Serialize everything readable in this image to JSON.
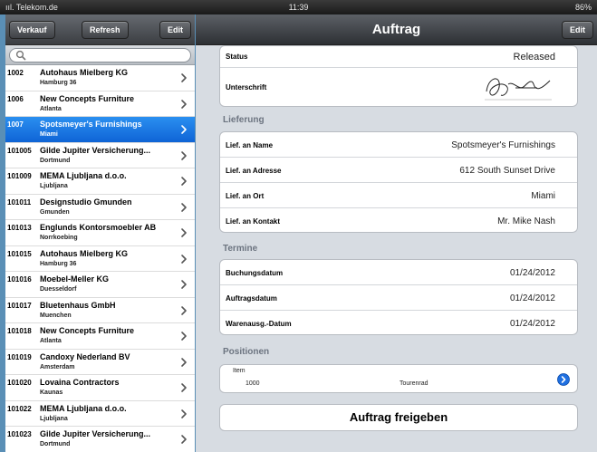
{
  "statusbar": {
    "carrier": "ııl. Telekom.de",
    "time": "11:39",
    "battery": "86%"
  },
  "master": {
    "nav": {
      "left_button": "Verkauf",
      "center_button": "Refresh",
      "right_button": "Edit"
    },
    "search": {
      "placeholder": ""
    },
    "rows": [
      {
        "num": "1002",
        "name": "Autohaus Mielberg KG",
        "city": "Hamburg 36"
      },
      {
        "num": "1006",
        "name": "New Concepts Furniture",
        "city": "Atlanta"
      },
      {
        "num": "1007",
        "name": "Spotsmeyer's Furnishings",
        "city": "Miami",
        "selected": true
      },
      {
        "num": "101005",
        "name": "Gilde Jupiter Versicherung...",
        "city": "Dortmund"
      },
      {
        "num": "101009",
        "name": "MEMA Ljubljana d.o.o.",
        "city": "Ljubljana"
      },
      {
        "num": "101011",
        "name": "Designstudio Gmunden",
        "city": "Gmunden"
      },
      {
        "num": "101013",
        "name": "Englunds Kontorsmoebler AB",
        "city": "Norrkoebing"
      },
      {
        "num": "101015",
        "name": "Autohaus Mielberg KG",
        "city": "Hamburg 36"
      },
      {
        "num": "101016",
        "name": "Moebel-Meller KG",
        "city": "Duesseldorf"
      },
      {
        "num": "101017",
        "name": "Bluetenhaus GmbH",
        "city": "Muenchen"
      },
      {
        "num": "101018",
        "name": "New Concepts Furniture",
        "city": "Atlanta"
      },
      {
        "num": "101019",
        "name": "Candoxy Nederland BV",
        "city": "Amsterdam"
      },
      {
        "num": "101020",
        "name": "Lovaina Contractors",
        "city": "Kaunas"
      },
      {
        "num": "101022",
        "name": "MEMA Ljubljana d.o.o.",
        "city": "Ljubljana"
      },
      {
        "num": "101023",
        "name": "Gilde Jupiter Versicherung...",
        "city": "Dortmund"
      }
    ]
  },
  "detail": {
    "title": "Auftrag",
    "edit_button": "Edit",
    "status_label": "Status",
    "status_value": "Released",
    "signature_label": "Unterschrift",
    "lieferung": {
      "title": "Lieferung",
      "rows": [
        {
          "label": "Lief. an Name",
          "value": "Spotsmeyer's Furnishings"
        },
        {
          "label": "Lief. an Adresse",
          "value": "612 South Sunset Drive"
        },
        {
          "label": "Lief. an Ort",
          "value": "Miami"
        },
        {
          "label": "Lief. an Kontakt",
          "value": "Mr. Mike Nash"
        }
      ]
    },
    "termine": {
      "title": "Termine",
      "rows": [
        {
          "label": "Buchungsdatum",
          "value": "01/24/2012"
        },
        {
          "label": "Auftragsdatum",
          "value": "01/24/2012"
        },
        {
          "label": "Warenausg.-Datum",
          "value": "01/24/2012"
        }
      ]
    },
    "positionen": {
      "title": "Positionen",
      "header": "Item",
      "item_number": "1000",
      "item_name": "Tourenrad"
    },
    "action_button": "Auftrag freigeben"
  },
  "colors": {
    "accent": "#1673e0",
    "nav_dark": "#3b3e42",
    "background": "#5a8fb6"
  }
}
